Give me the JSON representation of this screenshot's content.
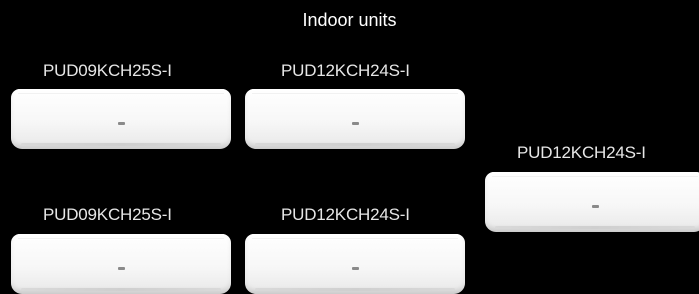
{
  "title": "Indoor units",
  "units": [
    {
      "label": "PUD09KCH25S-I"
    },
    {
      "label": "PUD12KCH24S-I"
    },
    {
      "label": "PUD12KCH24S-I"
    },
    {
      "label": "PUD09KCH25S-I"
    },
    {
      "label": "PUD12KCH24S-I"
    }
  ]
}
